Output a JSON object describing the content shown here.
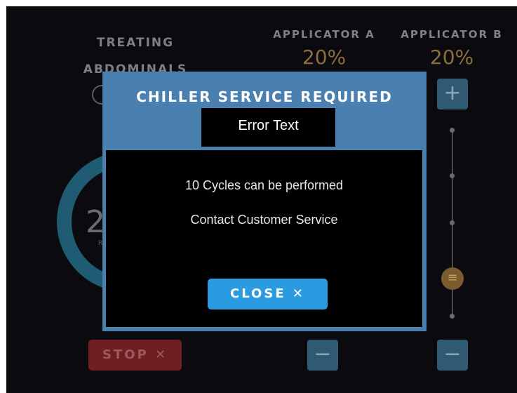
{
  "screen": {
    "treating_line1": "TREATING",
    "treating_line2": "ABDOMINALS",
    "applicator_a": {
      "label": "APPLICATOR A",
      "value": "20%"
    },
    "applicator_b": {
      "label": "APPLICATOR B",
      "value": "20%"
    },
    "ring_value": "2",
    "ring_subtext": "R",
    "stop_label": "STOP ✕",
    "plus_symbol": "+",
    "minus_symbol": "−",
    "slider_thumb_symbol": "≡"
  },
  "modal": {
    "title": "CHILLER SERVICE REQUIRED",
    "error_text": "Error Text",
    "message_1": "10 Cycles can be performed",
    "message_2": "Contact Customer Service",
    "close_label": "CLOSE ✕"
  },
  "colors": {
    "modal_frame": "#4a80af",
    "close_button": "#2a9be0",
    "stop_button": "#6e1f22",
    "ring": "#1f5c74",
    "percent_text": "#8b6d3e"
  }
}
